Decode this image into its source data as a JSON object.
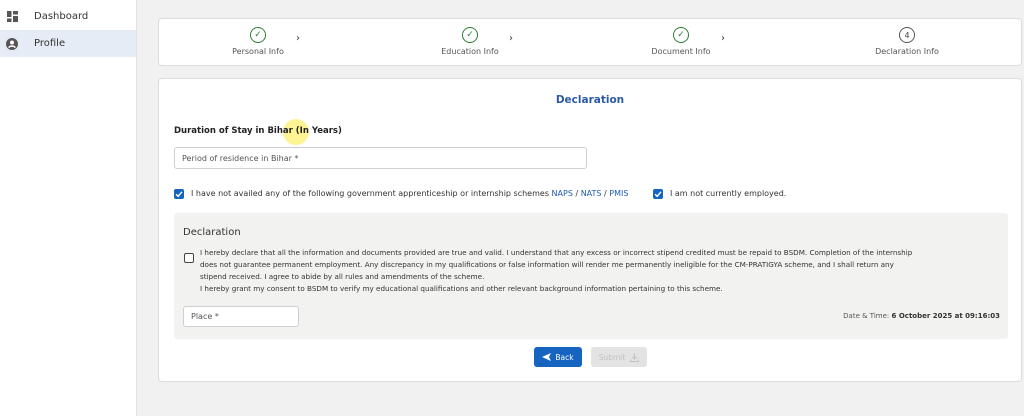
{
  "sidebar": {
    "items": [
      {
        "label": "Dashboard",
        "icon": "dashboard-icon"
      },
      {
        "label": "Profile",
        "icon": "user-icon"
      }
    ]
  },
  "stepper": {
    "steps": [
      {
        "label": "Personal Info",
        "status": "done",
        "marker": "✓"
      },
      {
        "label": "Education Info",
        "status": "done",
        "marker": "✓"
      },
      {
        "label": "Document Info",
        "status": "done",
        "marker": "✓"
      },
      {
        "label": "Declaration Info",
        "status": "current",
        "marker": "4"
      }
    ],
    "chevron": "›"
  },
  "form": {
    "title": "Declaration",
    "duration_label": "Duration of Stay in Bihar (In Years)",
    "period_placeholder": "Period of residence in Bihar *",
    "schemes_text": "I have not availed any of the following government apprenticeship or internship schemes",
    "scheme_links": [
      "NAPS",
      "NATS",
      "PMIS"
    ],
    "link_sep": " / ",
    "schemes_checked": true,
    "not_employed_text": "I am not currently employed.",
    "not_employed_checked": true
  },
  "declaration": {
    "heading": "Declaration",
    "checked": false,
    "lines": [
      "I hereby declare that all the information and documents provided are true and valid. I understand that any excess or incorrect stipend credited must be repaid to BSDM. Completion of the internship",
      "does not guarantee permanent employment. Any discrepancy in my qualifications or false information will render me permanently ineligible for the CM-PRATIGYA scheme, and I shall return any",
      "stipend received. I agree to abide by all rules and amendments of the scheme.",
      "I hereby grant my consent to BSDM to verify my educational qualifications and other relevant background information pertaining to this scheme."
    ],
    "place_placeholder": "Place *",
    "datetime_label": "Date & Time:",
    "datetime_value": "6 October 2025 at 09:16:03"
  },
  "buttons": {
    "back": "Back",
    "submit": "Submit"
  },
  "colors": {
    "accent": "#1565c0",
    "step_done": "#2e7d32",
    "title": "#2a5aa6"
  }
}
